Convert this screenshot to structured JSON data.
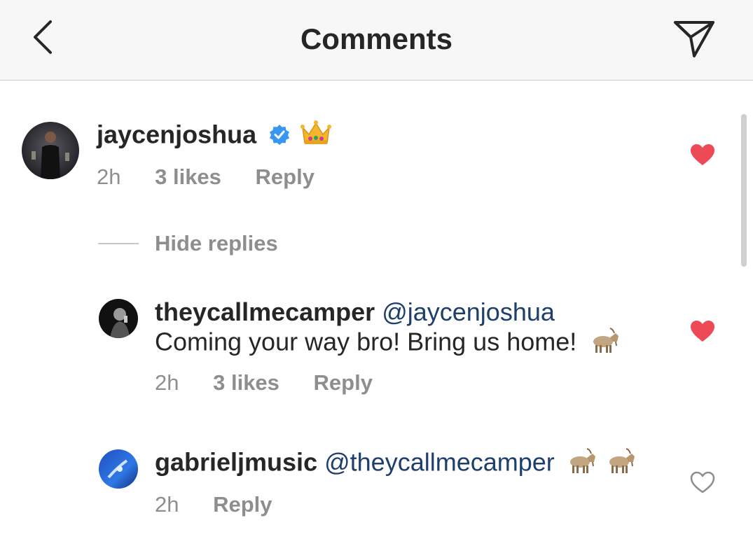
{
  "header": {
    "title": "Comments",
    "back_icon": "chevron-left-icon",
    "send_icon": "paper-plane-icon"
  },
  "colors": {
    "liked_heart": "#ed4956",
    "mention": "#1e3f6b",
    "meta_text": "#8e8e8e",
    "verified_badge": "#3897f0"
  },
  "comments": [
    {
      "username": "jaycenjoshua",
      "verified": true,
      "text_emoji": "crown",
      "time": "2h",
      "likes": "3 likes",
      "reply": "Reply",
      "liked": true
    }
  ],
  "hide_replies": "Hide replies",
  "replies": [
    {
      "username": "theycallmecamper",
      "mention": "@jaycenjoshua",
      "text": "Coming your way bro! Bring us home!",
      "text_emoji": "goat",
      "time": "2h",
      "likes": "3 likes",
      "reply": "Reply",
      "liked": true
    },
    {
      "username": "gabrieljmusic",
      "mention": "@theycallmecamper",
      "text_emoji": "goat goat",
      "time": "2h",
      "reply": "Reply",
      "liked": false
    }
  ]
}
